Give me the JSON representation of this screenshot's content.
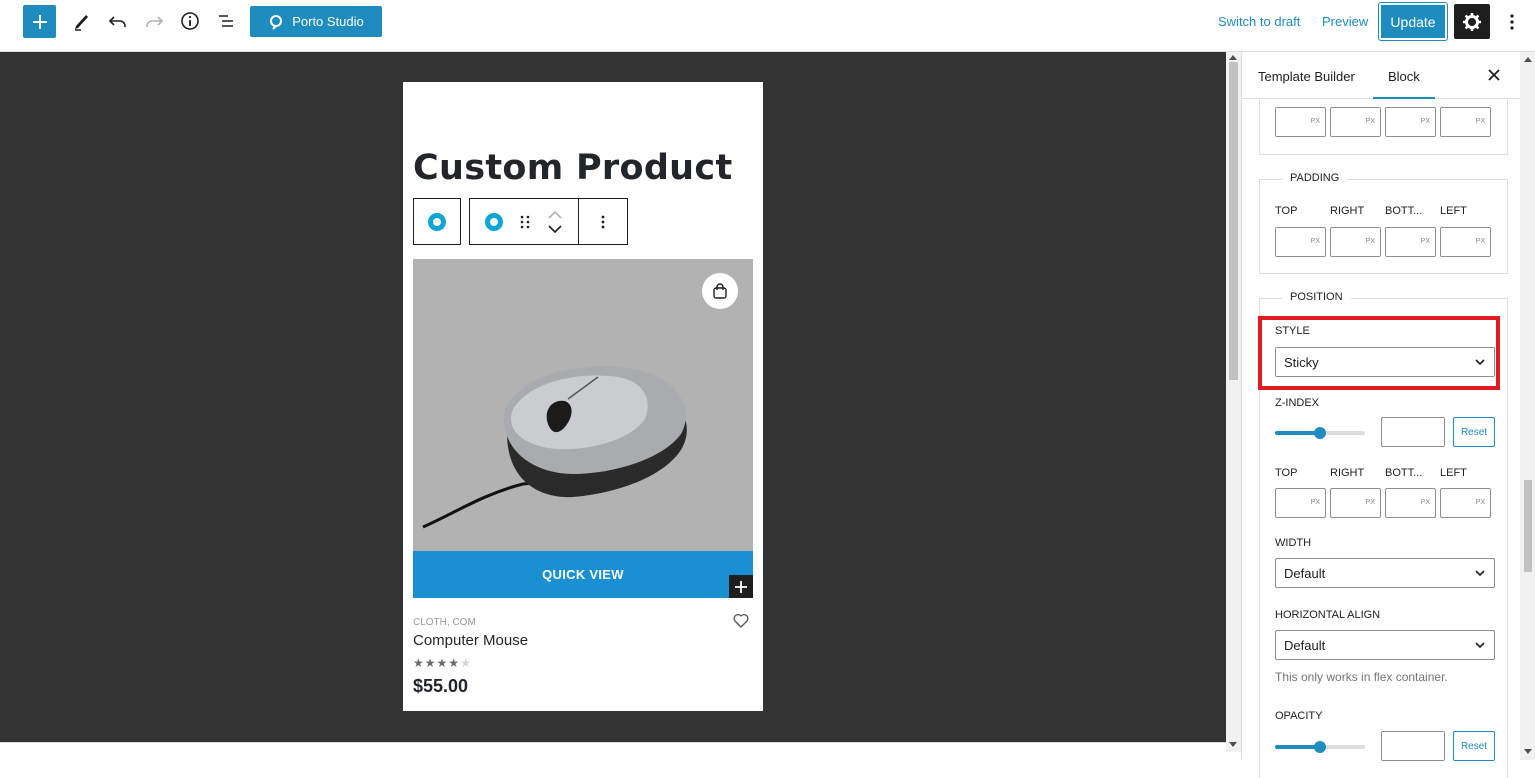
{
  "toolbar": {
    "add_icon": "plus-icon",
    "porto_studio_label": "Porto Studio",
    "switch_to_draft_label": "Switch to draft",
    "preview_label": "Preview",
    "update_label": "Update"
  },
  "canvas": {
    "page_title": "Custom Product",
    "product": {
      "quick_view_label": "QUICK VIEW",
      "category": "CLOTH, COM",
      "name": "Computer Mouse",
      "rating": 4,
      "rating_max": 5,
      "price": "$55.00"
    }
  },
  "sidebar": {
    "tabs": [
      {
        "label": "Template Builder",
        "active": false
      },
      {
        "label": "Block",
        "active": true
      }
    ],
    "unit_label": "PX",
    "padding": {
      "legend": "PADDING",
      "side_labels": [
        "TOP",
        "RIGHT",
        "BOTT...",
        "LEFT"
      ]
    },
    "position": {
      "legend": "POSITION",
      "style_label": "STYLE",
      "style_value": "Sticky",
      "zindex_label": "Z-INDEX",
      "zindex_slider_fraction": 0.5,
      "reset_label": "Reset",
      "side_labels": [
        "TOP",
        "RIGHT",
        "BOTT...",
        "LEFT"
      ],
      "width_label": "WIDTH",
      "width_value": "Default",
      "halign_label": "HORIZONTAL ALIGN",
      "halign_value": "Default",
      "halign_help": "This only works in flex container.",
      "opacity_label": "OPACITY",
      "opacity_slider_fraction": 0.5
    }
  },
  "colors": {
    "accent": "#1e8cbe",
    "canvas_bg": "#333333",
    "quick_view_bg": "#1a8fd1",
    "highlight": "#e11b22"
  }
}
